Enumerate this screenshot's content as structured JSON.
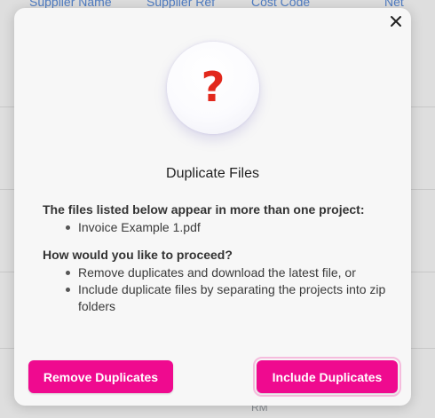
{
  "background": {
    "columns": [
      "Supplier Name",
      "Supplier Ref",
      "Cost Code",
      "Net"
    ],
    "footer_text": "RM"
  },
  "modal": {
    "close_icon": "close-icon",
    "question_icon": "question-mark-icon",
    "question_symbol": "?",
    "title": "Duplicate Files",
    "files_heading": "The files listed below appear in more than one project:",
    "files": [
      "Invoice Example 1.pdf"
    ],
    "proceed_heading": "How would you like to proceed?",
    "options": [
      "Remove duplicates and download the latest file, or",
      "Include duplicate files by separating the projects into zip folders"
    ],
    "remove_button": "Remove Duplicates",
    "include_button": "Include Duplicates"
  },
  "colors": {
    "accent": "#ef0a8f",
    "question_mark": "#e2281c",
    "header_link": "#5b8fe0"
  }
}
